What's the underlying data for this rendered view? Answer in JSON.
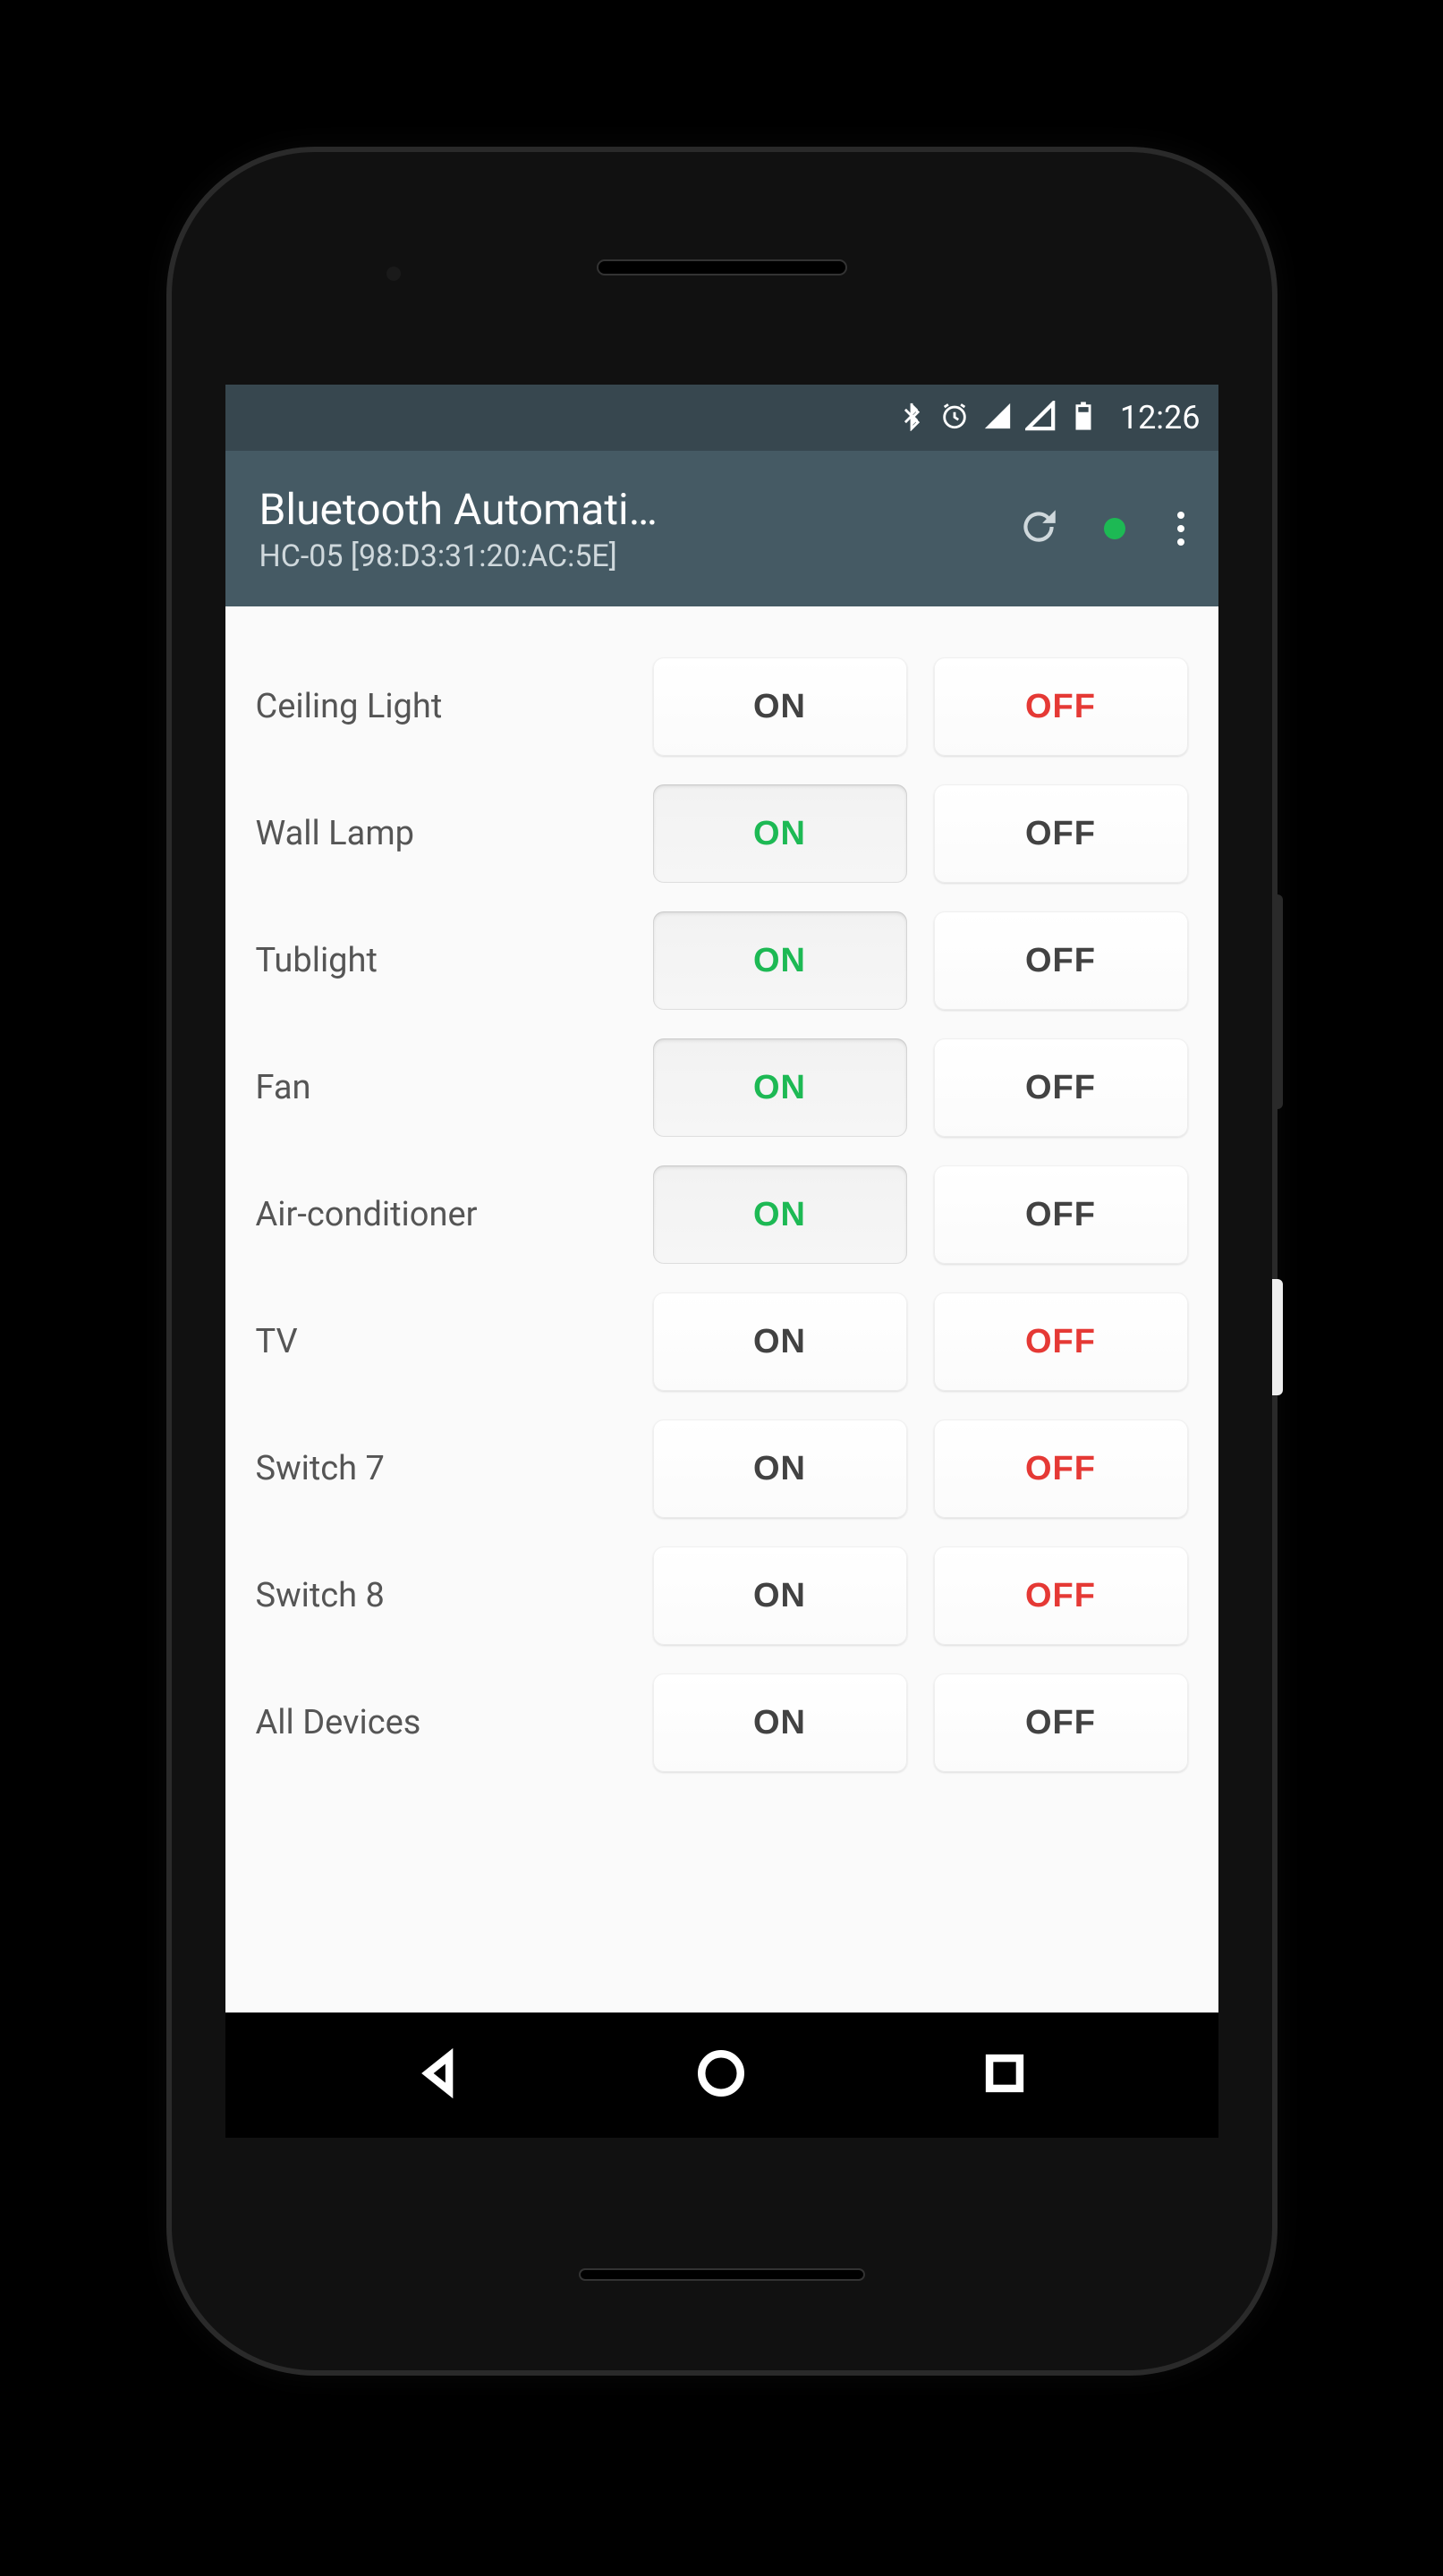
{
  "status": {
    "time": "12:26"
  },
  "appbar": {
    "title": "Bluetooth Automati…",
    "subtitle": "HC-05 [98:D3:31:20:AC:5E]"
  },
  "buttons": {
    "on": "ON",
    "off": "OFF"
  },
  "rows": [
    {
      "label": "Ceiling Light",
      "state": "off"
    },
    {
      "label": "Wall Lamp",
      "state": "on"
    },
    {
      "label": "Tublight",
      "state": "on"
    },
    {
      "label": "Fan",
      "state": "on"
    },
    {
      "label": "Air-conditioner",
      "state": "on"
    },
    {
      "label": "TV",
      "state": "off"
    },
    {
      "label": "Switch 7",
      "state": "off"
    },
    {
      "label": "Switch 8",
      "state": "off"
    },
    {
      "label": "All Devices",
      "state": "none"
    }
  ]
}
